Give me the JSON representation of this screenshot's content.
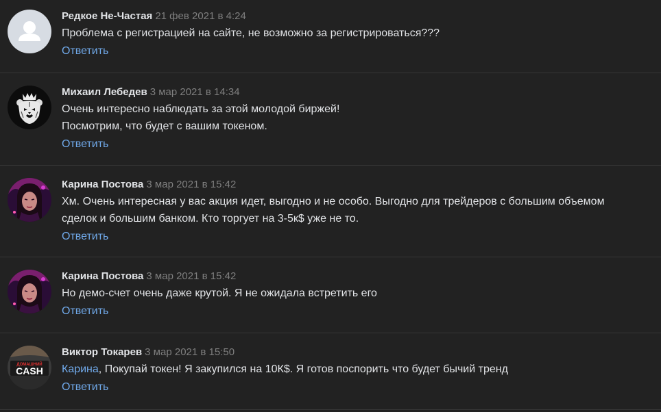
{
  "comments": [
    {
      "author": "Редкое Не-Частая",
      "date": "21 фев 2021 в 4:24",
      "lines": [
        "Проблема с регистрацией на сайте, не возможно за регистрироваться???"
      ],
      "reply": "Ответить",
      "avatar": "default-user-icon"
    },
    {
      "author": "Михаил Лебедев",
      "date": "3 мар 2021 в 14:34",
      "lines": [
        "Очень интересно наблюдать за этой молодой биржей!",
        "Посмотрим, что будет с вашим токеном."
      ],
      "reply": "Ответить",
      "avatar": "crowned-bear-icon"
    },
    {
      "author": "Карина Постова",
      "date": "3 мар 2021 в 15:42",
      "lines": [
        "Хм. Очень интересная у вас акция идет, выгодно и не особо. Выгодно для трейдеров с большим объемом",
        "сделок и большим банком. Кто торгует на 3-5к$ уже не то."
      ],
      "reply": "Ответить",
      "avatar": "portrait-photo"
    },
    {
      "author": "Карина Постова",
      "date": "3 мар 2021 в 15:42",
      "lines": [
        "Но демо-счет очень даже крутой. Я не ожидала встретить его"
      ],
      "reply": "Ответить",
      "avatar": "portrait-photo"
    },
    {
      "author": "Виктор Токарев",
      "date": "3 мар 2021 в 15:50",
      "mention": "Карина",
      "lines": [
        ", Покупай токен! Я закупился на 10К$. Я готов поспорить что будет бычий тренд"
      ],
      "reply": "Ответить",
      "avatar": "cash-logo"
    }
  ],
  "logo_text": {
    "top": "ДОМАШНИЙ",
    "main": "CASH"
  },
  "colors": {
    "background": "#222222",
    "text": "#e1e3e6",
    "muted": "#7f7f7f",
    "link": "#71aaeb",
    "divider": "#363636"
  }
}
